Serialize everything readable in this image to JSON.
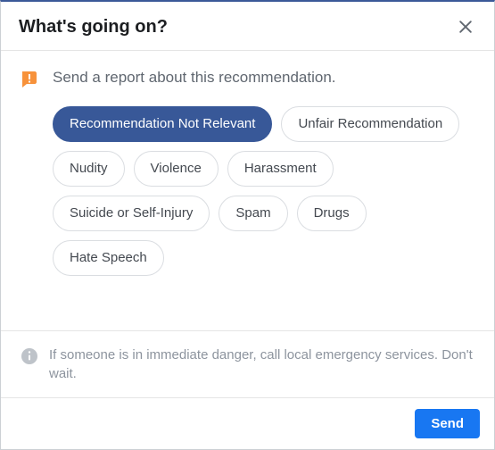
{
  "header": {
    "title": "What's going on?"
  },
  "report": {
    "prompt": "Send a report about this recommendation."
  },
  "options": [
    {
      "label": "Recommendation Not Relevant",
      "selected": true
    },
    {
      "label": "Unfair Recommendation",
      "selected": false
    },
    {
      "label": "Nudity",
      "selected": false
    },
    {
      "label": "Violence",
      "selected": false
    },
    {
      "label": "Harassment",
      "selected": false
    },
    {
      "label": "Suicide or Self-Injury",
      "selected": false
    },
    {
      "label": "Spam",
      "selected": false
    },
    {
      "label": "Drugs",
      "selected": false
    },
    {
      "label": "Hate Speech",
      "selected": false
    }
  ],
  "warning": {
    "text": "If someone is in immediate danger, call local emergency services. Don't wait."
  },
  "footer": {
    "send_label": "Send"
  },
  "colors": {
    "primary": "#1877f2",
    "chip_selected": "#385898",
    "text_muted": "#8d949e",
    "warning_icon": "#f5a623"
  }
}
